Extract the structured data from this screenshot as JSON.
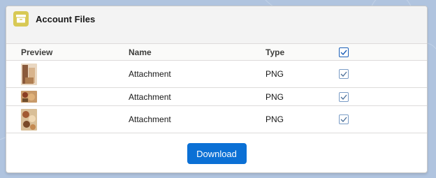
{
  "card": {
    "title": "Account Files",
    "icon": "files-icon",
    "accent_color": "#d8c955"
  },
  "table": {
    "columns": [
      "Preview",
      "Name",
      "Type",
      ""
    ],
    "header_checked": true,
    "rows": [
      {
        "name": "Attachment",
        "type": "PNG",
        "checked": true,
        "preview": "image-thumbnail"
      },
      {
        "name": "Attachment",
        "type": "PNG",
        "checked": true,
        "preview": "image-thumbnail"
      },
      {
        "name": "Attachment",
        "type": "PNG",
        "checked": true,
        "preview": "image-thumbnail"
      }
    ]
  },
  "actions": {
    "download_label": "Download",
    "button_color": "#0b70d5"
  }
}
